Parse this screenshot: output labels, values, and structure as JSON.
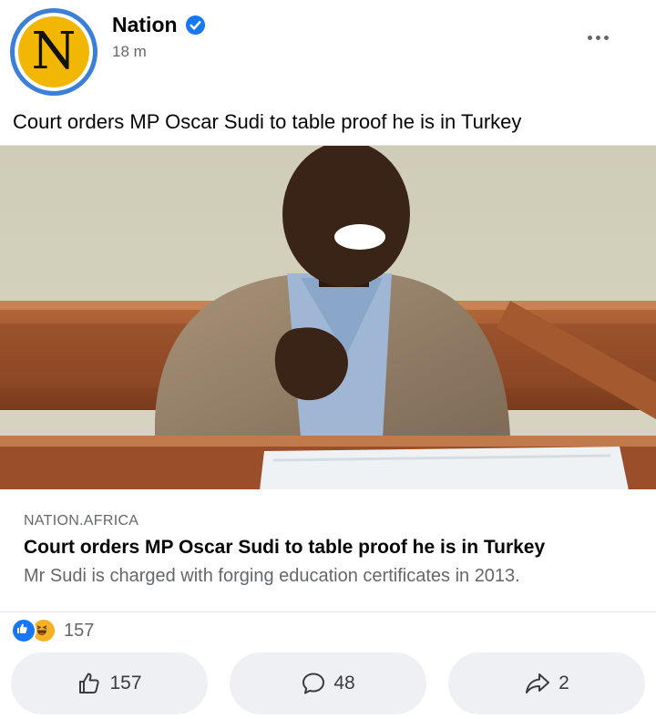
{
  "post": {
    "page_name": "Nation",
    "avatar_letter": "N",
    "time": "18 m",
    "caption": "Court orders MP Oscar Sudi to table proof he is in Turkey"
  },
  "link_preview": {
    "domain": "NATION.AFRICA",
    "title": "Court orders MP Oscar Sudi to table proof he is in Turkey",
    "description": "Mr Sudi is charged with forging education certificates in 2013."
  },
  "reactions": {
    "icons": [
      "like-reaction-icon",
      "haha-reaction-icon"
    ],
    "count": "157"
  },
  "actions": {
    "like_count": "157",
    "comment_count": "48",
    "share_count": "2"
  },
  "colors": {
    "accent": "#1877f2",
    "avatar_ring": "#3b7fd6",
    "avatar_fill": "#f2b705",
    "button_bg": "#eef0f3",
    "secondary_text": "#65676b"
  }
}
